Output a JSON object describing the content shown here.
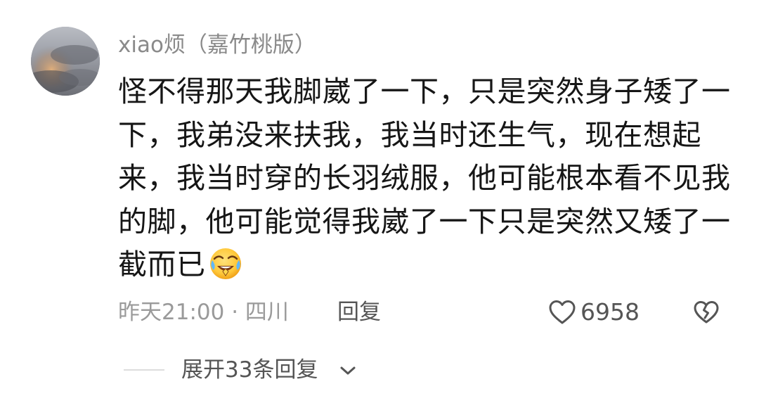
{
  "comment": {
    "username": "xiao烦（嘉竹桃版）",
    "body_lines": [
      "怪不得那天我脚崴了一下，只是突然身子矮了一",
      "下，我弟没来扶我，我当时还生气，现在想起",
      "来，我当时穿的长羽绒服，他可能根本看不见我",
      "的脚，他可能觉得我崴了一下只是突然又矮了一",
      "截而已"
    ],
    "emoji": "crying-laughing-emoji",
    "time": "昨天21:00",
    "separator": "·",
    "location": "四川",
    "reply_label": "回复",
    "like_count": "6958",
    "expand_label": "展开33条回复"
  },
  "icons": {
    "like": "heart-outline-icon",
    "dislike": "broken-heart-icon",
    "expand": "chevron-down-icon"
  },
  "colors": {
    "username": "#8a8a8a",
    "body_text": "#161616",
    "meta_text": "#9a9a9a",
    "action_text": "#555555"
  }
}
